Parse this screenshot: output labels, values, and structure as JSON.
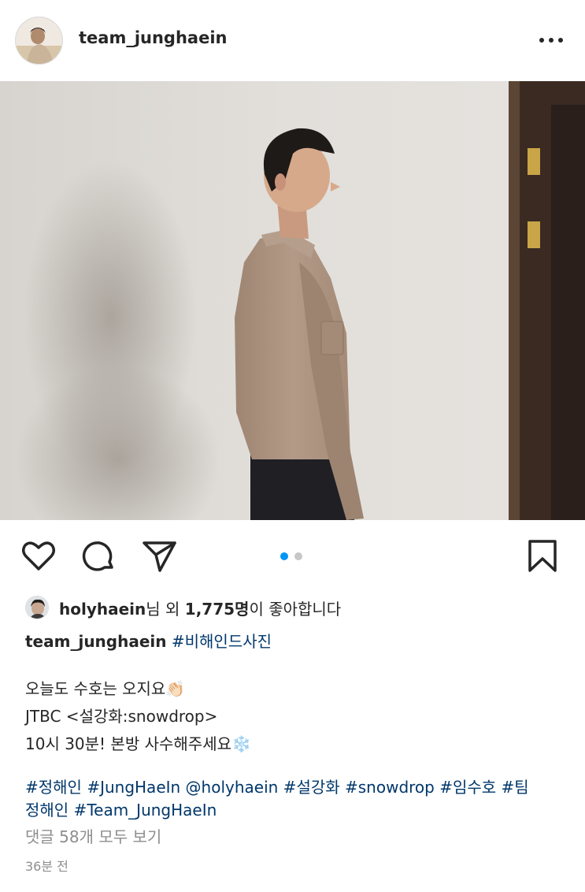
{
  "post": {
    "author": "team_junghaein",
    "more_icon": "more-horizontal-icon"
  },
  "carousel": {
    "total": 2,
    "active": 1,
    "active_color": "#0095f6",
    "inactive_color": "#c7c7c7"
  },
  "actions": {
    "icons": [
      "heart-icon",
      "comment-icon",
      "send-icon",
      "bookmark-icon"
    ]
  },
  "likes": {
    "user": "holyhaein",
    "suffix_1": "님 외 ",
    "count": "1,775명",
    "suffix_2": "이 좋아합니다"
  },
  "caption": {
    "username": "team_junghaein",
    "headline_tag": "#비해인드사진",
    "line1": "오늘도 수호는 오지요",
    "line1_emoji": "👏🏻",
    "line2": "JTBC <설강화:snowdrop>",
    "line3": "10시 30분! 본방 사수해주세요",
    "line3_emoji": "❄️",
    "tags_line1": "#정해인 #JungHaeIn @holyhaein #설강화 #snowdrop #임수호 #팀",
    "tags_line2": "정해인 #Team_JungHaeIn"
  },
  "comments_link": "댓글 58개 모두 보기",
  "timestamp": "36분 전"
}
